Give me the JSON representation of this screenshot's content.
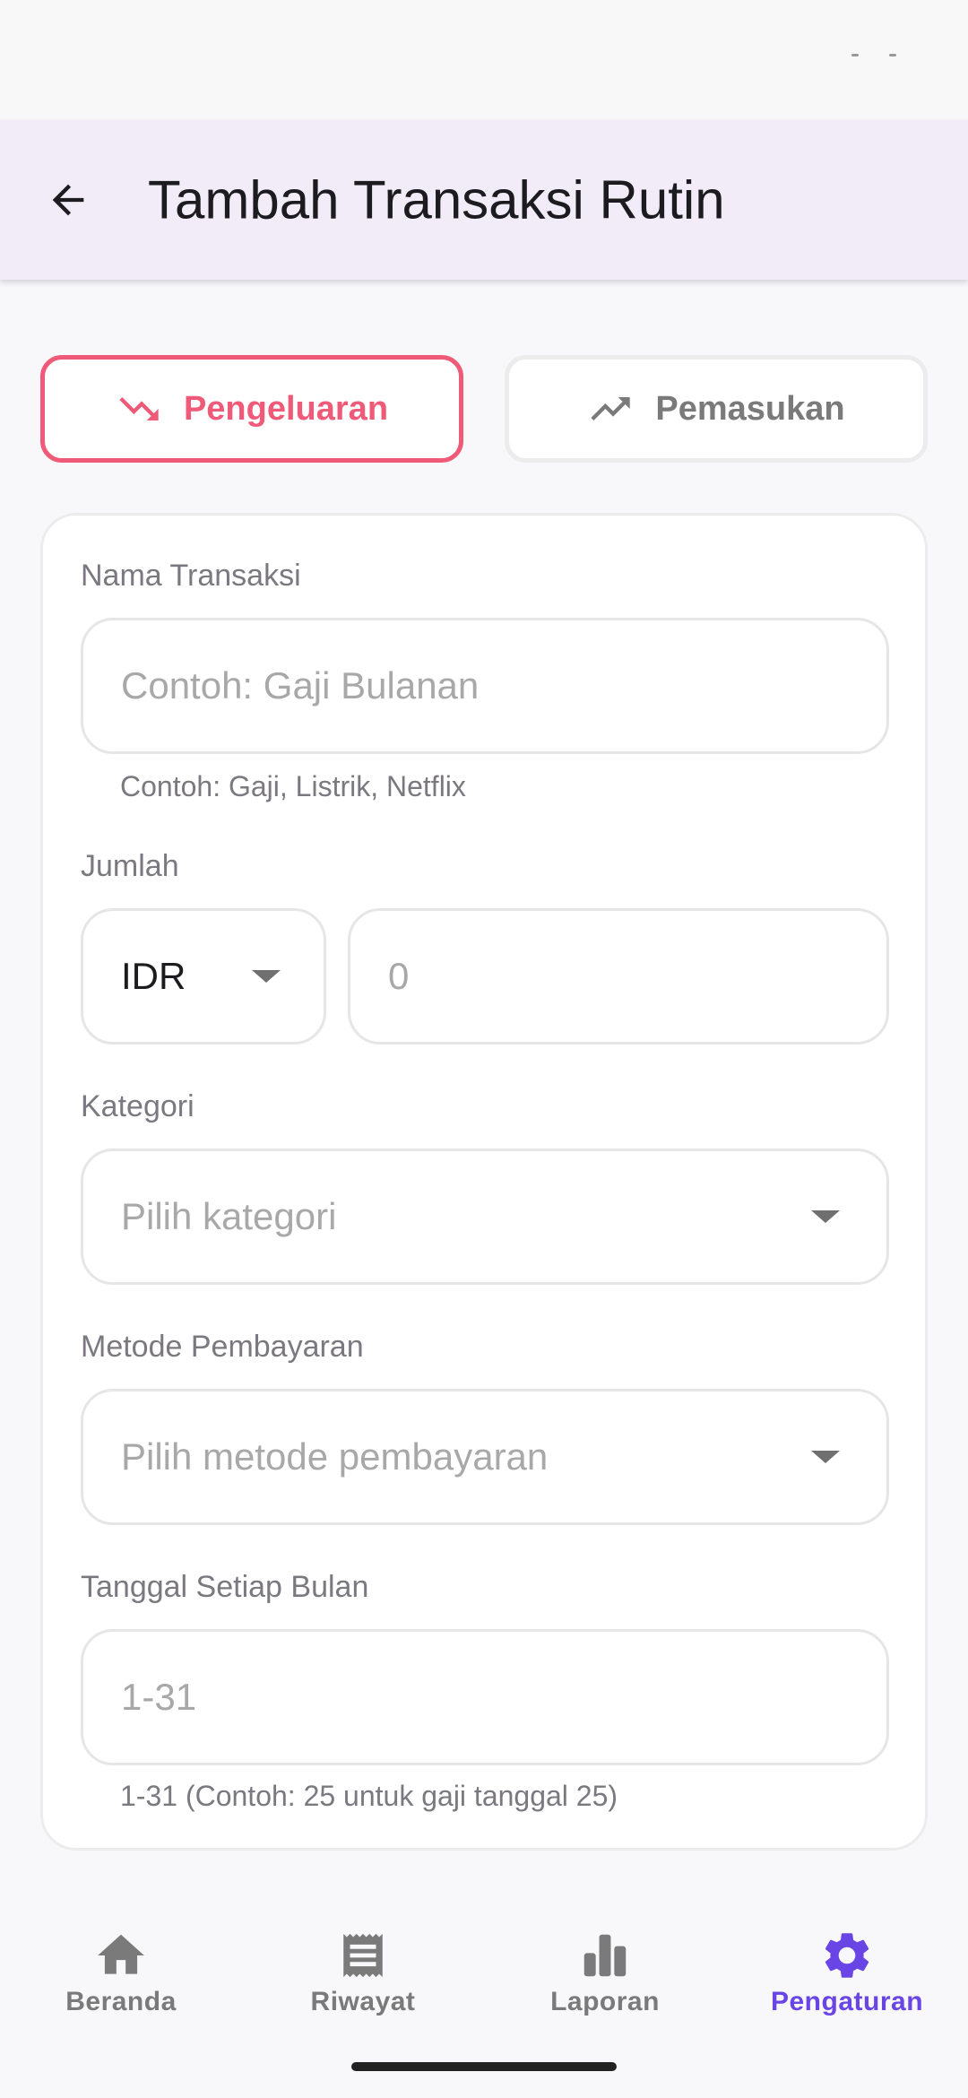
{
  "app_bar": {
    "title": "Tambah Transaksi Rutin"
  },
  "type_toggle": {
    "expense_label": "Pengeluaran",
    "income_label": "Pemasukan",
    "selected": "expense"
  },
  "form": {
    "name": {
      "label": "Nama Transaksi",
      "placeholder": "Contoh: Gaji Bulanan",
      "helper": "Contoh: Gaji, Listrik, Netflix"
    },
    "amount": {
      "label": "Jumlah",
      "currency": "IDR",
      "placeholder": "0"
    },
    "category": {
      "label": "Kategori",
      "placeholder": "Pilih kategori"
    },
    "payment_method": {
      "label": "Metode Pembayaran",
      "placeholder": "Pilih metode pembayaran"
    },
    "day_of_month": {
      "label": "Tanggal Setiap Bulan",
      "placeholder": "1-31",
      "helper": "1-31 (Contoh: 25 untuk gaji tanggal 25)"
    }
  },
  "bottom_nav": {
    "items": [
      {
        "label": "Beranda",
        "icon": "home-icon"
      },
      {
        "label": "Riwayat",
        "icon": "receipt-icon"
      },
      {
        "label": "Laporan",
        "icon": "bar-chart-icon"
      },
      {
        "label": "Pengaturan",
        "icon": "gear-icon"
      }
    ],
    "active_index": 3
  },
  "colors": {
    "expense_accent": "#ef5a78",
    "nav_active": "#6a45e6",
    "app_bar_bg": "#f1ecf7"
  }
}
